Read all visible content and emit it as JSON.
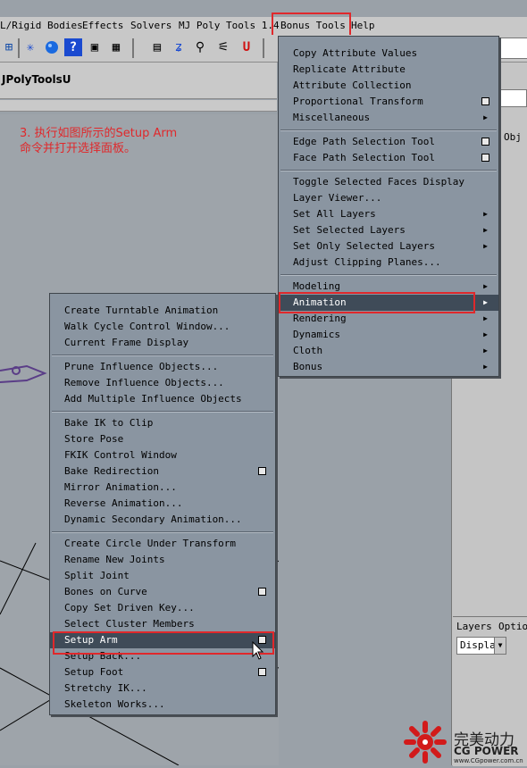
{
  "menubar": {
    "items": [
      "L/Rigid Bodies",
      "Effects",
      "Solvers",
      "MJ Poly Tools 1.4",
      "Bonus Tools",
      "Help"
    ]
  },
  "shelf": {
    "title": "JPolyToolsU"
  },
  "note": {
    "line1": "3. 执行如图所示的Setup Arm",
    "line2": "命令并打开选择面板。"
  },
  "bonus_menu": {
    "groups": [
      [
        {
          "label": "Copy Attribute Values"
        },
        {
          "label": "Replicate Attribute"
        },
        {
          "label": "Attribute Collection"
        },
        {
          "label": "Proportional Transform",
          "option": true
        },
        {
          "label": "Miscellaneous",
          "submenu": true
        }
      ],
      [
        {
          "label": "Edge Path Selection Tool",
          "option": true
        },
        {
          "label": "Face Path Selection Tool",
          "option": true
        }
      ],
      [
        {
          "label": "Toggle Selected Faces Display"
        },
        {
          "label": "Layer Viewer..."
        },
        {
          "label": "Set All Layers",
          "submenu": true
        },
        {
          "label": "Set Selected Layers",
          "submenu": true
        },
        {
          "label": "Set Only Selected Layers",
          "submenu": true
        },
        {
          "label": "Adjust Clipping Planes..."
        }
      ],
      [
        {
          "label": "Modeling",
          "submenu": true
        },
        {
          "label": "Animation",
          "submenu": true,
          "highlight": true
        },
        {
          "label": "Rendering",
          "submenu": true
        },
        {
          "label": "Dynamics",
          "submenu": true
        },
        {
          "label": "Cloth",
          "submenu": true
        },
        {
          "label": "Bonus",
          "submenu": true
        }
      ]
    ]
  },
  "animation_menu": {
    "groups": [
      [
        {
          "label": "Create Turntable Animation"
        },
        {
          "label": "Walk Cycle Control Window..."
        },
        {
          "label": "Current Frame Display"
        }
      ],
      [
        {
          "label": "Prune Influence Objects..."
        },
        {
          "label": "Remove Influence Objects..."
        },
        {
          "label": "Add Multiple Influence Objects"
        }
      ],
      [
        {
          "label": "Bake IK to Clip"
        },
        {
          "label": "Store Pose"
        },
        {
          "label": "FKIK Control Window"
        },
        {
          "label": "Bake Redirection",
          "option": true
        },
        {
          "label": "Mirror Animation..."
        },
        {
          "label": "Reverse Animation..."
        },
        {
          "label": "Dynamic Secondary Animation..."
        }
      ],
      [
        {
          "label": "Create Circle Under Transform"
        },
        {
          "label": "Rename New Joints"
        },
        {
          "label": "Split Joint"
        },
        {
          "label": "Bones on Curve",
          "option": true
        },
        {
          "label": "Copy Set Driven Key..."
        },
        {
          "label": "Select Cluster Members"
        },
        {
          "label": "Setup Arm",
          "option": true,
          "highlight": true
        },
        {
          "label": "Setup Back..."
        },
        {
          "label": "Setup Foot",
          "option": true
        },
        {
          "label": "Stretchy IK..."
        },
        {
          "label": "Skeleton Works..."
        }
      ]
    ]
  },
  "right_panel": {
    "tab": "Obj",
    "layers_menu": [
      "Layers",
      "Options"
    ],
    "display_select": "Display"
  },
  "watermark": {
    "brand": "完美动力",
    "sub": "CG POWER",
    "url": "www.CGpower.com.cn"
  }
}
